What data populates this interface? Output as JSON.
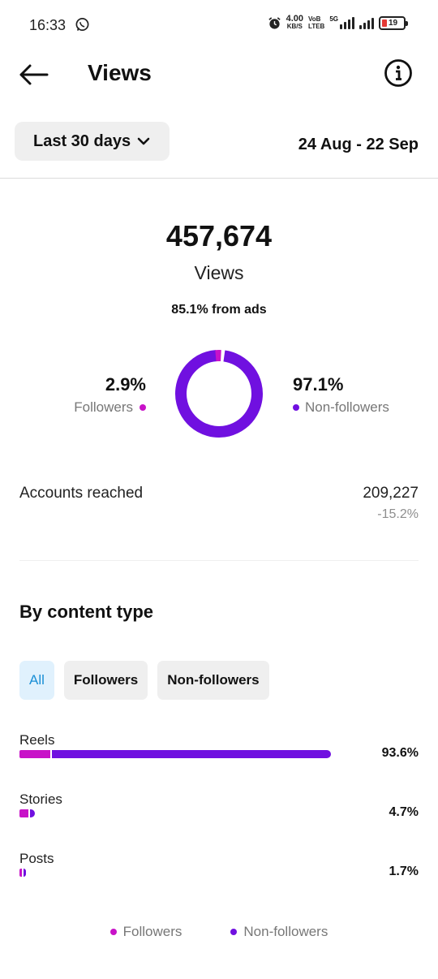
{
  "status_bar": {
    "time": "16:33",
    "net_speed_value": "4.00",
    "net_speed_unit": "KB/S",
    "volte_top": "VoB",
    "volte_bottom": "LTEB",
    "signal_label": "5G",
    "battery_level": "19",
    "icons": [
      "whatsapp-icon",
      "alarm-icon",
      "signal-icon",
      "battery-icon"
    ],
    "battery_color": "#e53935"
  },
  "header": {
    "title": "Views",
    "back_icon": "arrow-left-icon",
    "info_icon": "info-icon"
  },
  "filter": {
    "range_label": "Last 30 days",
    "range_icon": "chevron-down-icon",
    "date_range": "24 Aug - 22 Sep"
  },
  "summary": {
    "total_views": "457,674",
    "views_label": "Views",
    "ads_share": "85.1% from ads",
    "followers_pct": "2.9%",
    "followers_label": "Followers",
    "non_followers_pct": "97.1%",
    "non_followers_label": "Non-followers",
    "followers_fraction": 0.029,
    "non_followers_fraction": 0.971
  },
  "colors": {
    "followers": "#c812c8",
    "non_followers": "#7010e0",
    "chip_active_bg": "#e0f1fd",
    "chip_active_text": "#1a8fd6"
  },
  "accounts_reached": {
    "label": "Accounts reached",
    "value": "209,227",
    "change": "-15.2%"
  },
  "content_type": {
    "title": "By content type",
    "chips": [
      {
        "label": "All",
        "active": true
      },
      {
        "label": "Followers",
        "active": false
      },
      {
        "label": "Non-followers",
        "active": false
      }
    ],
    "rows": [
      {
        "label": "Reels",
        "percent": "93.6%",
        "share": 0.936,
        "followers_share": 0.1
      },
      {
        "label": "Stories",
        "percent": "4.7%",
        "share": 0.047,
        "followers_share": 0.55
      },
      {
        "label": "Posts",
        "percent": "1.7%",
        "share": 0.017,
        "followers_share": 0.25
      }
    ],
    "legend": [
      "Followers",
      "Non-followers"
    ]
  }
}
